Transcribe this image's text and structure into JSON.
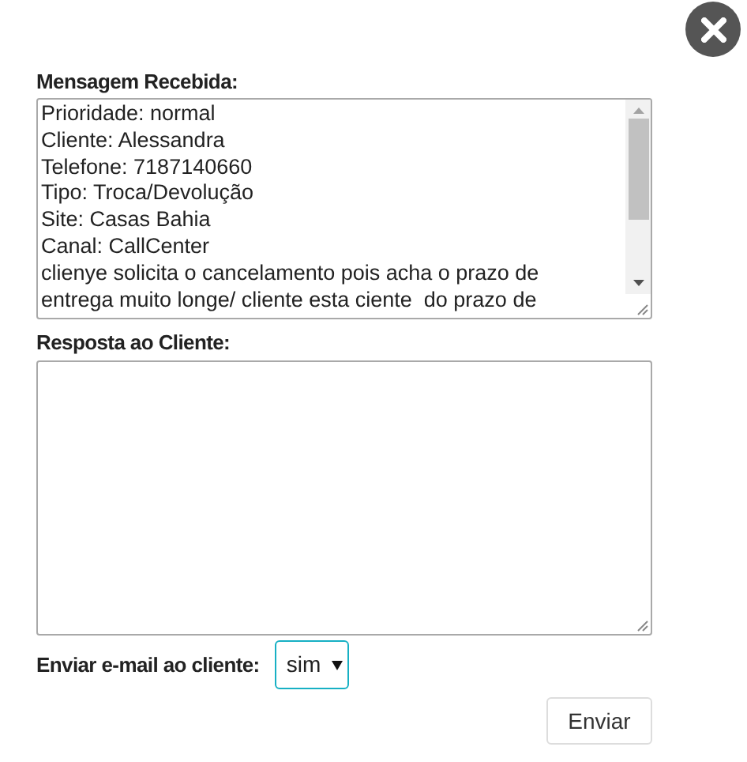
{
  "message": {
    "label": "Mensagem Recebida:",
    "lines": [
      "Prioridade: normal",
      "Cliente: Alessandra",
      "Telefone: 7187140660",
      "Tipo: Troca/Devolução",
      "Site: Casas Bahia",
      "Canal: CallCenter",
      "clienye solicita o cancelamento pois acha o prazo de",
      "entrega muito longe/ cliente esta ciente  do prazo de"
    ]
  },
  "reply": {
    "label": "Resposta ao Cliente:"
  },
  "email": {
    "label": "Enviar e-mail ao cliente:",
    "value": "sim"
  },
  "submit": "Enviar"
}
